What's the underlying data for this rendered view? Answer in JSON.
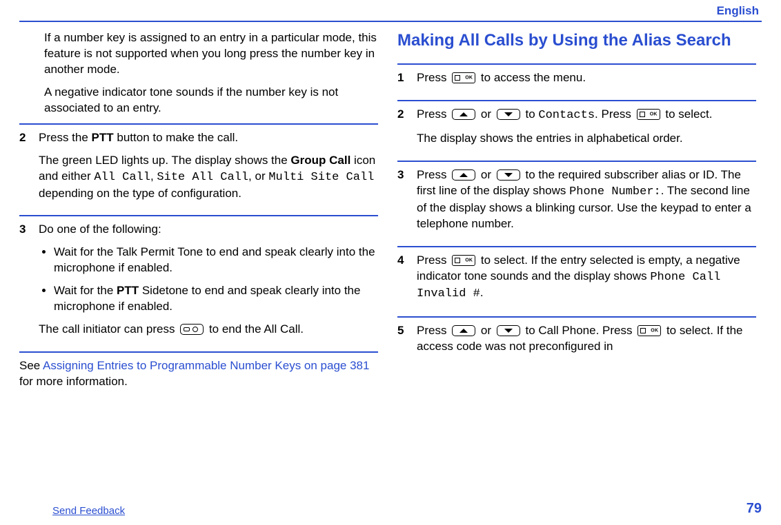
{
  "header": {
    "language": "English"
  },
  "left": {
    "intro": {
      "p1": "If a number key is assigned to an entry in a particular mode, this feature is not supported when you long press the number key in another mode.",
      "p2": "A negative indicator tone sounds if the number key is not associated to an entry."
    },
    "step2": {
      "num": "2",
      "lead_a": "Press the ",
      "ptt": "PTT",
      "lead_b": " button to make the call.",
      "body_a": "The green LED lights up. The display shows the ",
      "group_call": "Group Call",
      "body_b": " icon and either ",
      "all_call": "All Call",
      "body_c": ", ",
      "site_all_call": "Site All Call",
      "body_d": ", or ",
      "multi_site_call": "Multi Site Call",
      "body_e": " depending on the type of configuration."
    },
    "step3": {
      "num": "3",
      "lead": "Do one of the following:",
      "bullet1": "Wait for the Talk Permit Tone to end and speak clearly into the microphone if enabled.",
      "bullet2_a": "Wait for the ",
      "bullet2_ptt": "PTT",
      "bullet2_b": " Sidetone to end and speak clearly into the microphone if enabled.",
      "closing_a": "The call initiator can press ",
      "closing_b": " to end the All Call."
    },
    "see": {
      "a": "See ",
      "link": "Assigning Entries to Programmable Number Keys on page 381",
      "b": " for more information."
    }
  },
  "right": {
    "title": "Making All Calls by Using the Alias Search",
    "s1": {
      "num": "1",
      "a": "Press ",
      "b": " to access the menu."
    },
    "s2": {
      "num": "2",
      "a": "Press ",
      "or": " or ",
      "b": " to ",
      "contacts": "Contacts",
      "c": ". Press ",
      "d": " to select.",
      "e": "The display shows the entries in alphabetical order."
    },
    "s3": {
      "num": "3",
      "a": "Press ",
      "or": " or ",
      "b": " to the required subscriber alias or ID. The first line of the display shows ",
      "phone_number": "Phone Number:",
      "c": ". The second line of the display shows a blinking cursor. Use the keypad to enter a telephone number."
    },
    "s4": {
      "num": "4",
      "a": "Press ",
      "b": " to select. If the entry selected is empty, a negative indicator tone sounds and the display shows ",
      "invalid": "Phone Call Invalid #",
      "c": "."
    },
    "s5": {
      "num": "5",
      "a": "Press ",
      "or": " or ",
      "b": " to Call Phone. Press ",
      "c": " to select. If the access code was not preconfigured in"
    }
  },
  "footer": {
    "feedback": "Send Feedback",
    "page": "79"
  }
}
